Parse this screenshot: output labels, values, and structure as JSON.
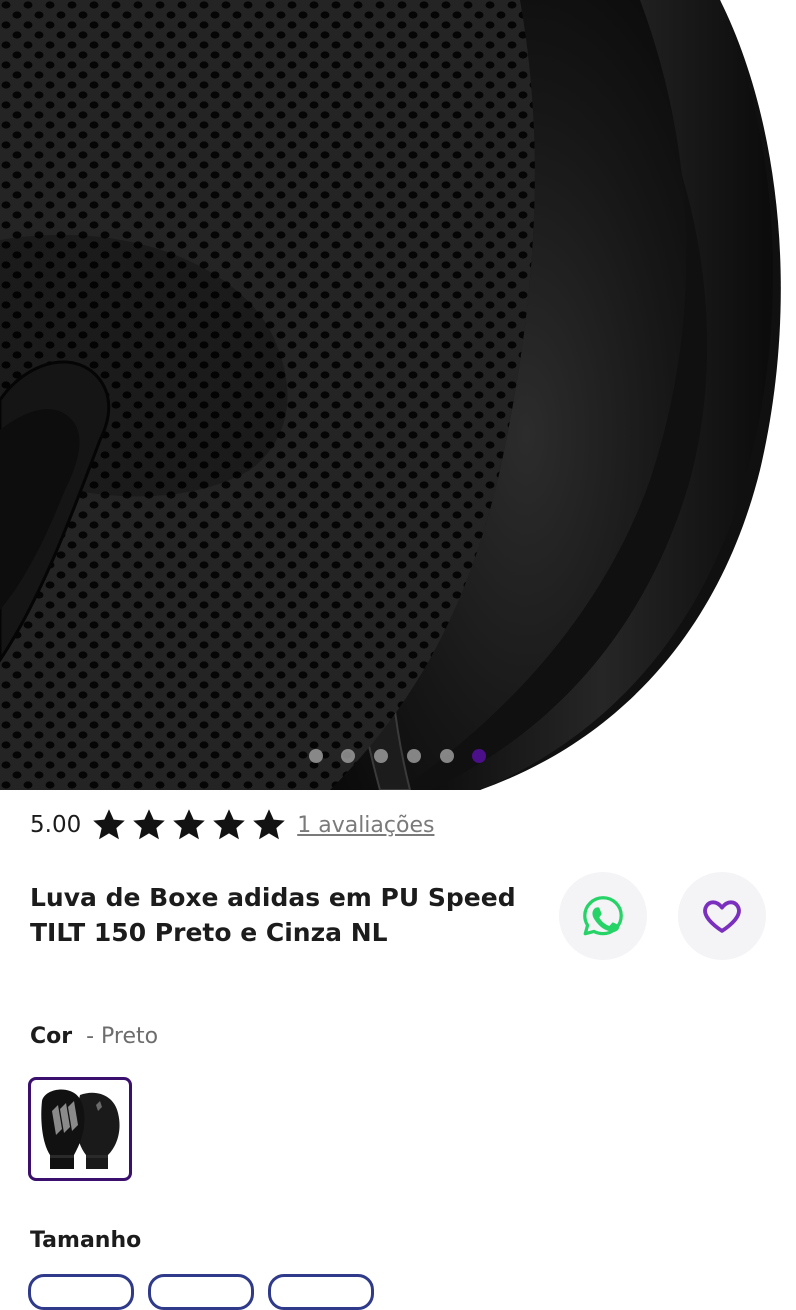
{
  "gallery": {
    "image_alt": "Luva de Boxe adidas - detalhe interno",
    "slide_count": 6,
    "active_slide": 6
  },
  "rating": {
    "value": "5.00",
    "stars": 5,
    "reviews_text": "1 avaliações"
  },
  "product": {
    "title": "Luva de Boxe adidas em PU Speed TILT 150 Preto e Cinza NL"
  },
  "actions": {
    "whatsapp_icon": "whatsapp-icon",
    "favorite_icon": "heart-icon"
  },
  "color": {
    "label": "Cor",
    "selected": "- Preto"
  },
  "size": {
    "label": "Tamanho"
  },
  "colors": {
    "accent": "#4b0f8a",
    "whatsapp": "#25d366",
    "heart": "#7b2fbe"
  }
}
